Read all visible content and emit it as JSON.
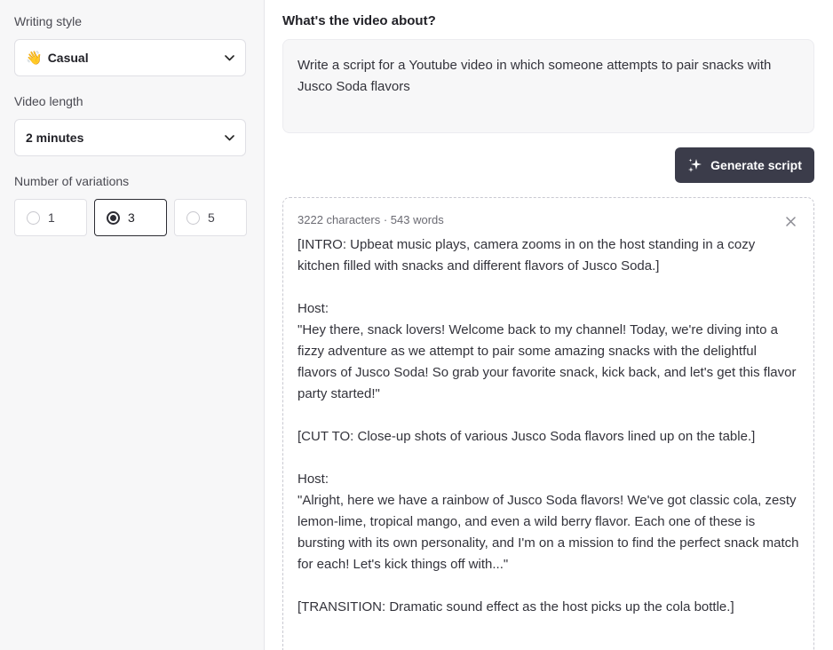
{
  "sidebar": {
    "writing_style_label": "Writing style",
    "writing_style_value": "Casual",
    "writing_style_emoji": "👋",
    "video_length_label": "Video length",
    "video_length_value": "2 minutes",
    "variations_label": "Number of variations",
    "variations": [
      {
        "label": "1",
        "selected": false
      },
      {
        "label": "3",
        "selected": true
      },
      {
        "label": "5",
        "selected": false
      }
    ]
  },
  "main": {
    "title": "What's the video about?",
    "prompt": "Write a script for a Youtube video in which someone attempts to pair snacks with Jusco Soda flavors",
    "generate_label": "Generate script",
    "result": {
      "meta": "3222 characters · 543 words",
      "lines": [
        "[INTRO: Upbeat music plays, camera zooms in on the host standing in a cozy kitchen filled with snacks and different flavors of Jusco Soda.]",
        "",
        "Host:",
        "\"Hey there, snack lovers! Welcome back to my channel! Today, we're diving into a fizzy adventure as we attempt to pair some amazing snacks with the delightful flavors of Jusco Soda! So grab your favorite snack, kick back, and let's get this flavor party started!\"",
        "",
        "[CUT TO: Close-up shots of various Jusco Soda flavors lined up on the table.]",
        "",
        "Host:",
        "\"Alright, here we have a rainbow of Jusco Soda flavors! We've got classic cola, zesty lemon-lime, tropical mango, and even a wild berry flavor. Each one of these is bursting with its own personality, and I'm on a mission to find the perfect snack match for each! Let's kick things off with...\"",
        "",
        "[TRANSITION: Dramatic sound effect as the host picks up the cola bottle.]"
      ]
    }
  },
  "icons": {
    "chevron": "chevron-down-icon",
    "sparkle": "sparkle-icon",
    "close": "close-icon",
    "wave": "waving-hand-icon"
  },
  "colors": {
    "button_bg": "#3b3c4a",
    "sidebar_bg": "#f7f7f8",
    "selected_border": "#2c2c33"
  }
}
